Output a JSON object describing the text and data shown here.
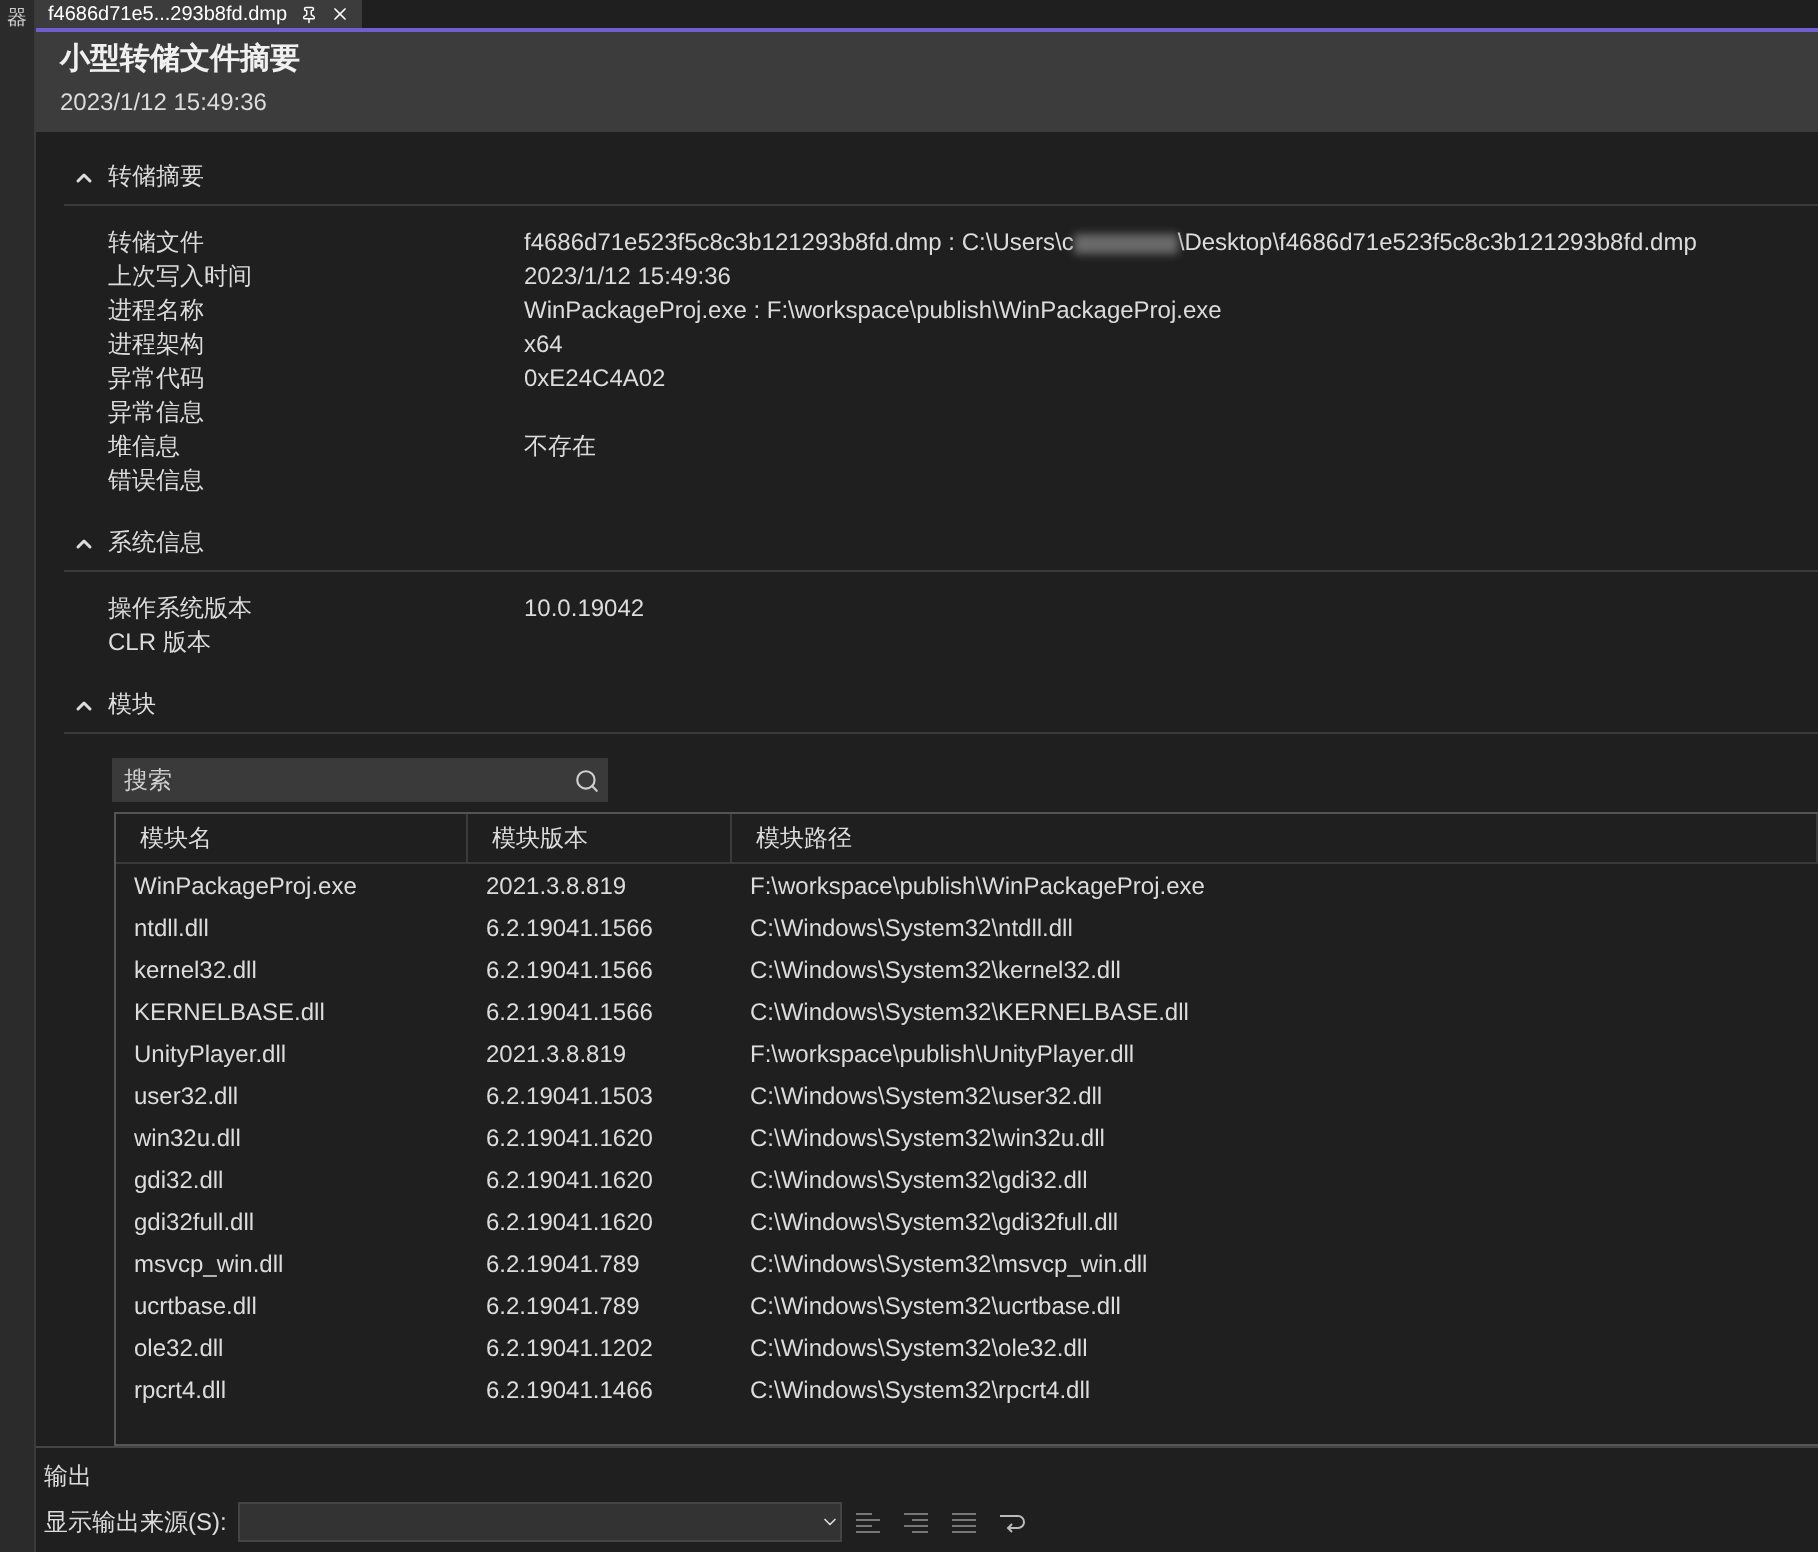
{
  "side_tab": {
    "label": "器"
  },
  "document_tab": {
    "title": "f4686d71e5...293b8fd.dmp",
    "selected": true
  },
  "header": {
    "title": "小型转储文件摘要",
    "subtitle": "2023/1/12 15:49:36"
  },
  "sections": [
    {
      "title": "转储摘要",
      "expanded": true,
      "kind": "properties",
      "rows": [
        {
          "label": "转储文件",
          "value": "f4686d71e523f5c8c3b121293b8fd.dmp : C:\\Users\\c",
          "redacted": true,
          "value_after": "\\Desktop\\f4686d71e523f5c8c3b121293b8fd.dmp"
        },
        {
          "label": "上次写入时间",
          "value": "2023/1/12 15:49:36"
        },
        {
          "label": "进程名称",
          "value": "WinPackageProj.exe : F:\\workspace\\publish\\WinPackageProj.exe"
        },
        {
          "label": "进程架构",
          "value": "x64"
        },
        {
          "label": "异常代码",
          "value": "0xE24C4A02"
        },
        {
          "label": "异常信息"
        },
        {
          "label": "堆信息",
          "value": "不存在"
        },
        {
          "label": "错误信息"
        }
      ]
    },
    {
      "title": "系统信息",
      "expanded": true,
      "kind": "properties",
      "rows": [
        {
          "label": "操作系统版本",
          "value": "10.0.19042"
        },
        {
          "label": "CLR 版本"
        }
      ]
    },
    {
      "title": "模块",
      "expanded": true,
      "kind": "table",
      "search": {
        "placeholder": "搜索"
      },
      "columns": [
        "模块名",
        "模块版本",
        "模块路径"
      ],
      "rows": [
        [
          "WinPackageProj.exe",
          "2021.3.8.819",
          "F:\\workspace\\publish\\WinPackageProj.exe"
        ],
        [
          "ntdll.dll",
          "6.2.19041.1566",
          "C:\\Windows\\System32\\ntdll.dll"
        ],
        [
          "kernel32.dll",
          "6.2.19041.1566",
          "C:\\Windows\\System32\\kernel32.dll"
        ],
        [
          "KERNELBASE.dll",
          "6.2.19041.1566",
          "C:\\Windows\\System32\\KERNELBASE.dll"
        ],
        [
          "UnityPlayer.dll",
          "2021.3.8.819",
          "F:\\workspace\\publish\\UnityPlayer.dll"
        ],
        [
          "user32.dll",
          "6.2.19041.1503",
          "C:\\Windows\\System32\\user32.dll"
        ],
        [
          "win32u.dll",
          "6.2.19041.1620",
          "C:\\Windows\\System32\\win32u.dll"
        ],
        [
          "gdi32.dll",
          "6.2.19041.1620",
          "C:\\Windows\\System32\\gdi32.dll"
        ],
        [
          "gdi32full.dll",
          "6.2.19041.1620",
          "C:\\Windows\\System32\\gdi32full.dll"
        ],
        [
          "msvcp_win.dll",
          "6.2.19041.789",
          "C:\\Windows\\System32\\msvcp_win.dll"
        ],
        [
          "ucrtbase.dll",
          "6.2.19041.789",
          "C:\\Windows\\System32\\ucrtbase.dll"
        ],
        [
          "ole32.dll",
          "6.2.19041.1202",
          "C:\\Windows\\System32\\ole32.dll"
        ],
        [
          "rpcrt4.dll",
          "6.2.19041.1466",
          "C:\\Windows\\System32\\rpcrt4.dll"
        ]
      ]
    }
  ],
  "output": {
    "title": "输出",
    "source_label": "显示输出来源(S):"
  }
}
